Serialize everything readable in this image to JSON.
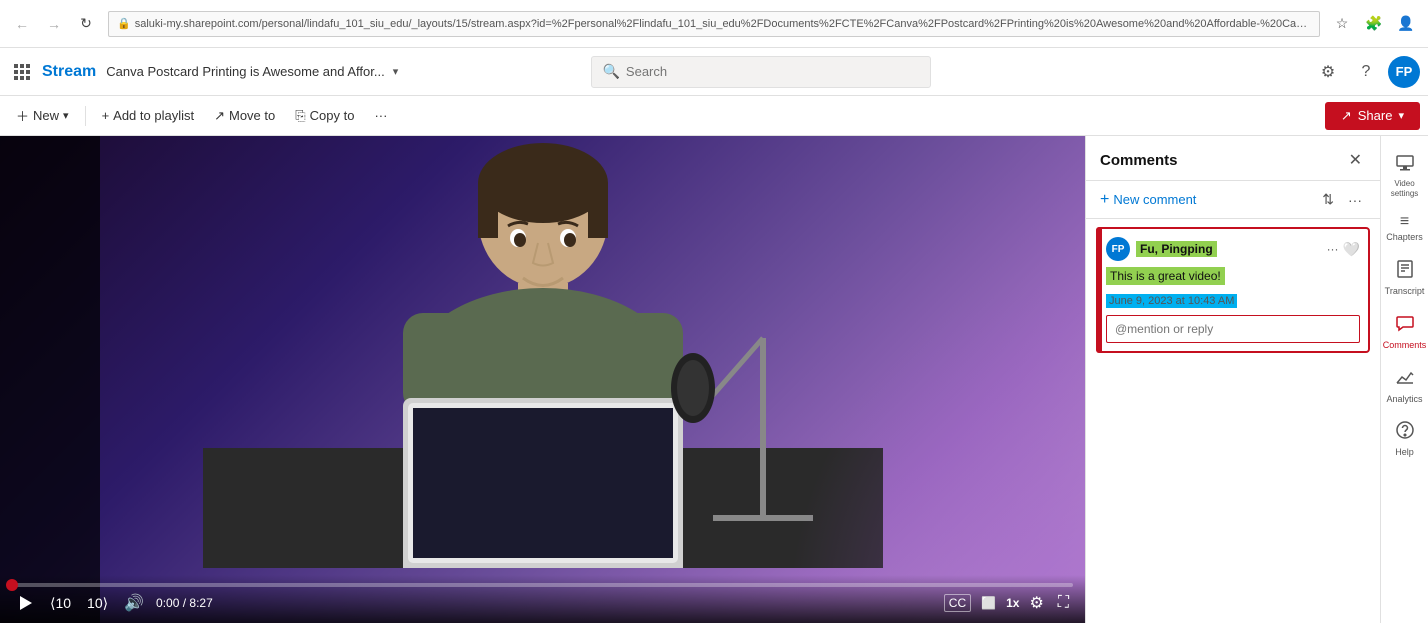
{
  "browser": {
    "back_disabled": true,
    "forward_disabled": true,
    "url": "saluki-my.sharepoint.com/personal/lindafu_101_siu_edu/_layouts/15/stream.aspx?id=%2Fpersonal%2Flindafu_101_siu_edu%2FDocuments%2FCTE%2FCanva%2FPostcard%2FPrinting%20is%20Awesome%20and%20Affordable-%20CanvaLove%2Emp4&ref...",
    "favicon": "🎬"
  },
  "appbar": {
    "app_name": "Stream",
    "breadcrumb": "Canva Postcard Printing is Awesome and Affor...",
    "search_placeholder": "Search"
  },
  "toolbar": {
    "new_label": "New",
    "add_to_playlist_label": "Add to playlist",
    "move_to_label": "Move to",
    "copy_to_label": "Copy to",
    "share_label": "Share"
  },
  "video": {
    "time_current": "0:00",
    "time_total": "8:27",
    "speed": "1x"
  },
  "comments_panel": {
    "title": "Comments",
    "new_comment_label": "New comment",
    "comments": [
      {
        "id": "c1",
        "author": "Fu, Pingping",
        "avatar_initials": "FP",
        "text": "This is a great video!",
        "timestamp": "June 9, 2023 at 10:43 AM",
        "reply_placeholder": "@mention or reply",
        "active": true
      }
    ]
  },
  "right_sidebar": {
    "items": [
      {
        "id": "video-settings",
        "icon": "⚙",
        "label": "Video settings"
      },
      {
        "id": "chapters",
        "icon": "≡",
        "label": "Chapters"
      },
      {
        "id": "transcript",
        "icon": "📄",
        "label": "Transcript"
      },
      {
        "id": "comments",
        "icon": "💬",
        "label": "Comments",
        "active": true
      },
      {
        "id": "analytics",
        "icon": "📊",
        "label": "Analytics"
      },
      {
        "id": "help",
        "icon": "?",
        "label": "Help"
      }
    ]
  }
}
